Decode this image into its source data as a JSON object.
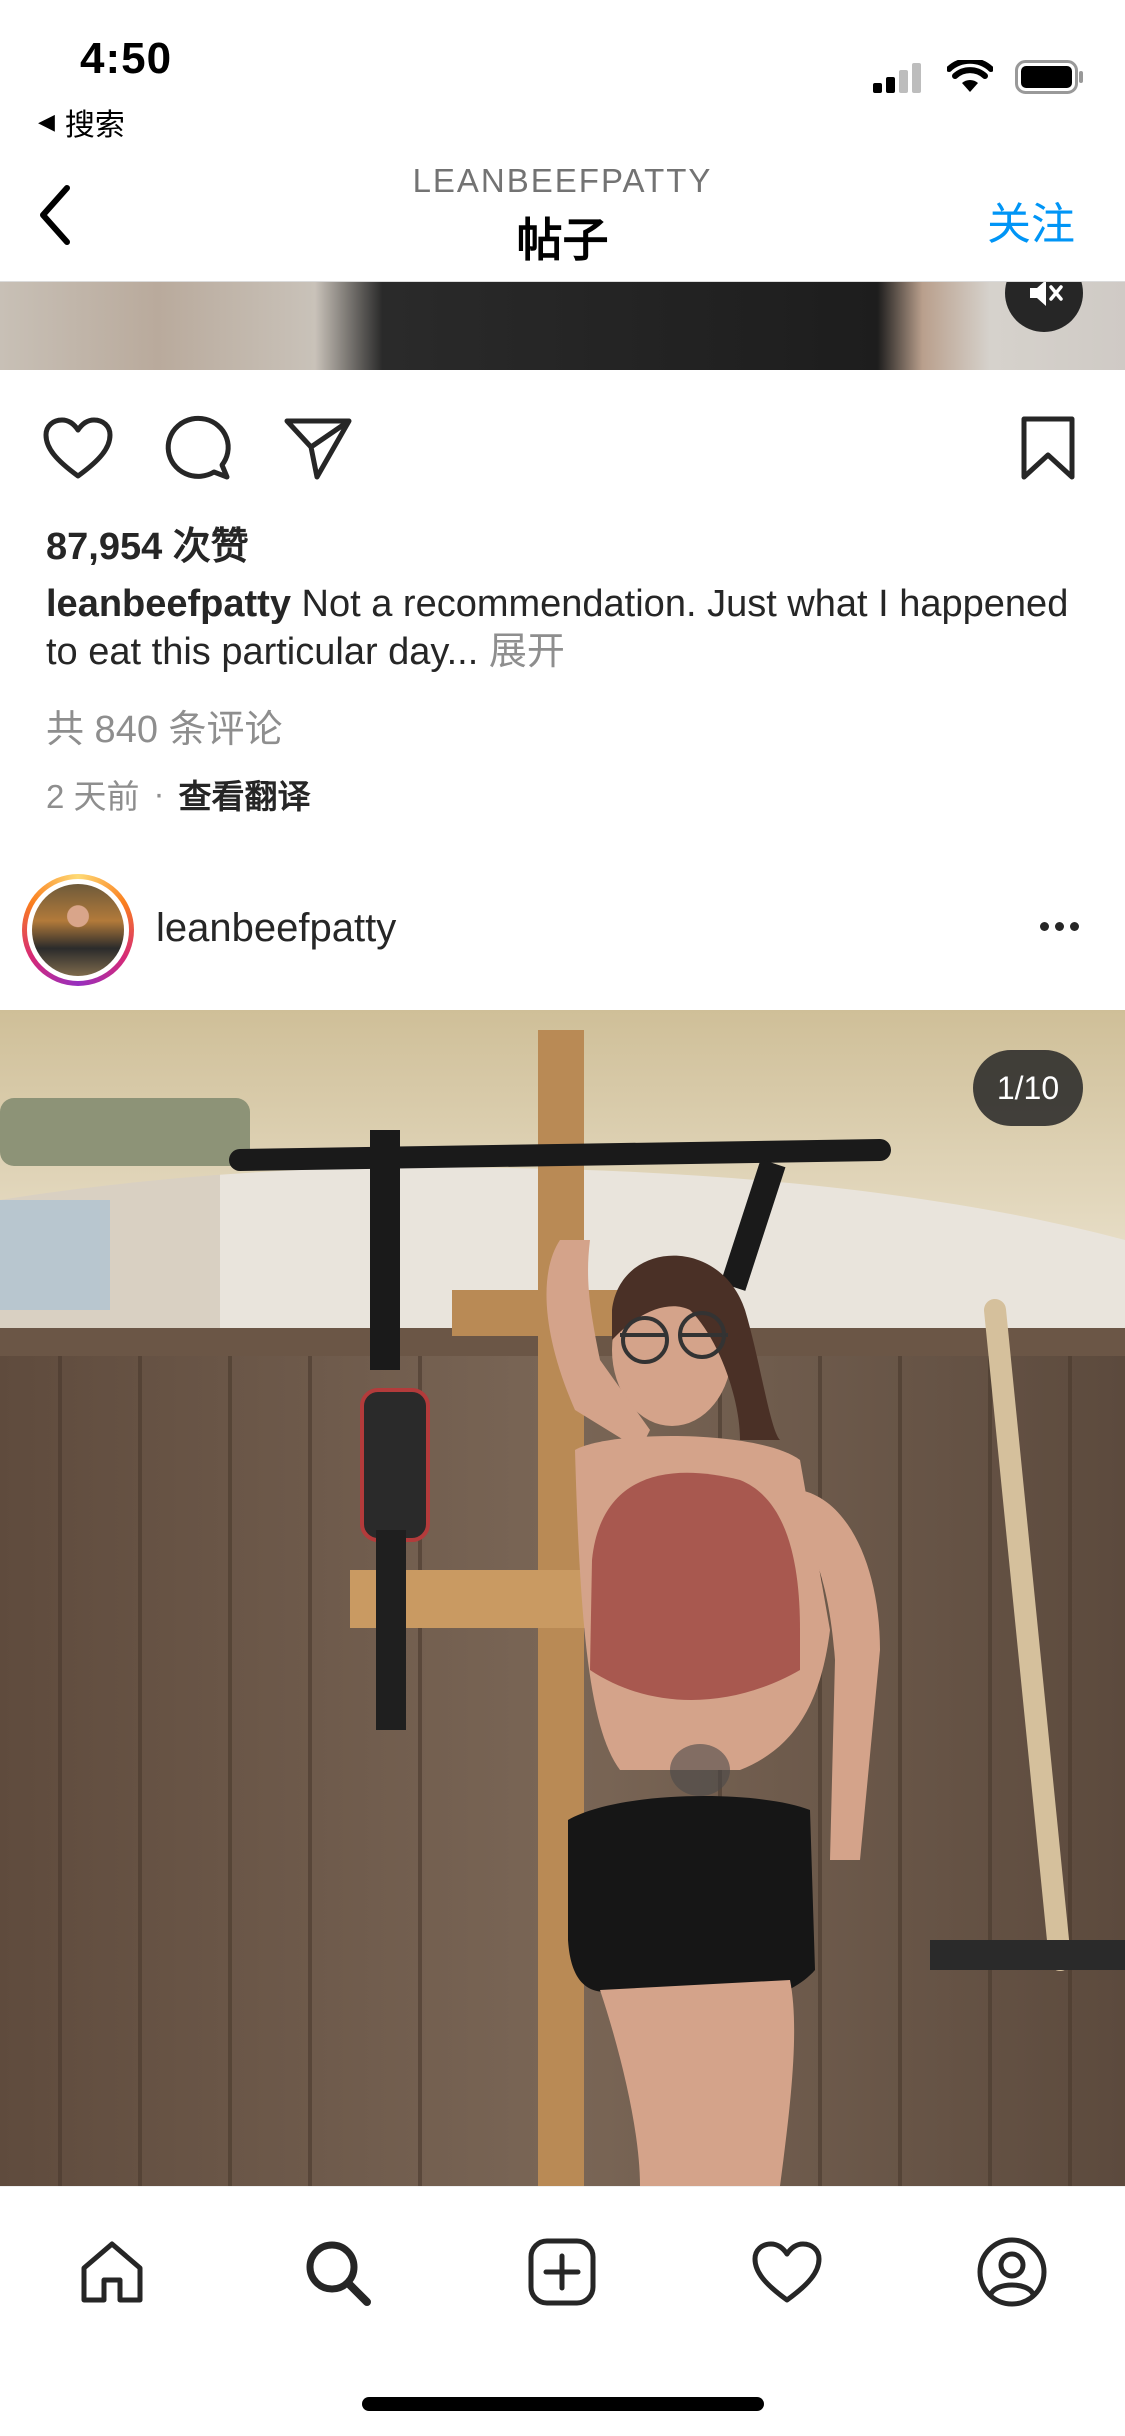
{
  "status_bar": {
    "time": "4:50",
    "back_app_label": "搜索"
  },
  "nav": {
    "username": "LEANBEEFPATTY",
    "title": "帖子",
    "follow_label": "关注"
  },
  "post": {
    "likes": "87,954 次赞",
    "caption_user": "leanbeefpatty",
    "caption_text": "Not a recommendation. Just what I happened to eat this particular day...",
    "caption_more": "展开",
    "comments_link": "共 840 条评论",
    "time_ago": "2 天前",
    "separator": "·",
    "translate_label": "查看翻译"
  },
  "next_post": {
    "username": "leanbeefpatty",
    "media_counter": "1/10"
  },
  "icons": {
    "back": "chevron-left-icon",
    "like": "heart-icon",
    "comment": "comment-bubble-icon",
    "share": "paper-plane-icon",
    "save": "bookmark-icon",
    "mute": "speaker-muted-icon",
    "more": "more-dots-icon",
    "tab_home": "home-icon",
    "tab_search": "search-icon",
    "tab_create": "plus-square-icon",
    "tab_activity": "heart-icon",
    "tab_profile": "profile-icon"
  },
  "colors": {
    "accent": "#0095f6",
    "text": "#262626",
    "secondary_text": "#8e8e8e"
  }
}
